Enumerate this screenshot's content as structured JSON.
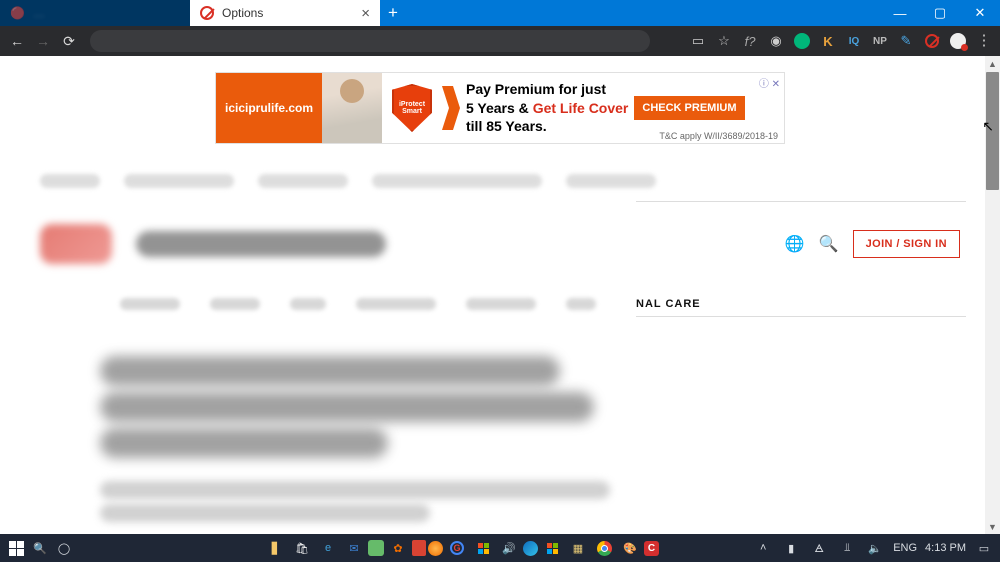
{
  "title_bar": {
    "inactive_tab_text": "…",
    "active_tab_text": "Options",
    "close_glyph": "×",
    "new_tab_glyph": "+",
    "min_glyph": "—",
    "max_glyph": "▢",
    "close_win_glyph": "✕"
  },
  "nav": {
    "back": "←",
    "forward": "→",
    "reload": "⟳",
    "star": "☆"
  },
  "ext": {
    "card": "▭",
    "star": "☆",
    "fq": "f?",
    "cam": "◉",
    "g_color": "#00B67A",
    "k": "K",
    "iq": "IQ",
    "np": "NP",
    "pen": "✎"
  },
  "ad": {
    "brand": "iciciprulife.com",
    "shield1": "iProtect",
    "shield2": "Smart",
    "line1": "Pay Premium for just",
    "line2a": "5 Years & ",
    "line2b": "Get Life Cover",
    "line3": "till 85 Years.",
    "cta": "CHECK PREMIUM",
    "tc": "T&C apply W/II/3689/2018-19",
    "info": "ⓘ ✕"
  },
  "page": {
    "lang_icon": "🌐",
    "search_icon": "🔍",
    "join_label": "JOIN / SIGN IN",
    "nal_care": "NAL CARE"
  },
  "taskbar": {
    "search": "🔍",
    "cortana": "◯",
    "tray_up": "˄ ",
    "battery": "▮",
    "wifi": "⫫",
    "net": "🜁",
    "vol": "🔈",
    "lang": "ENG",
    "time": "4:13 PM",
    "notif": "▭"
  }
}
